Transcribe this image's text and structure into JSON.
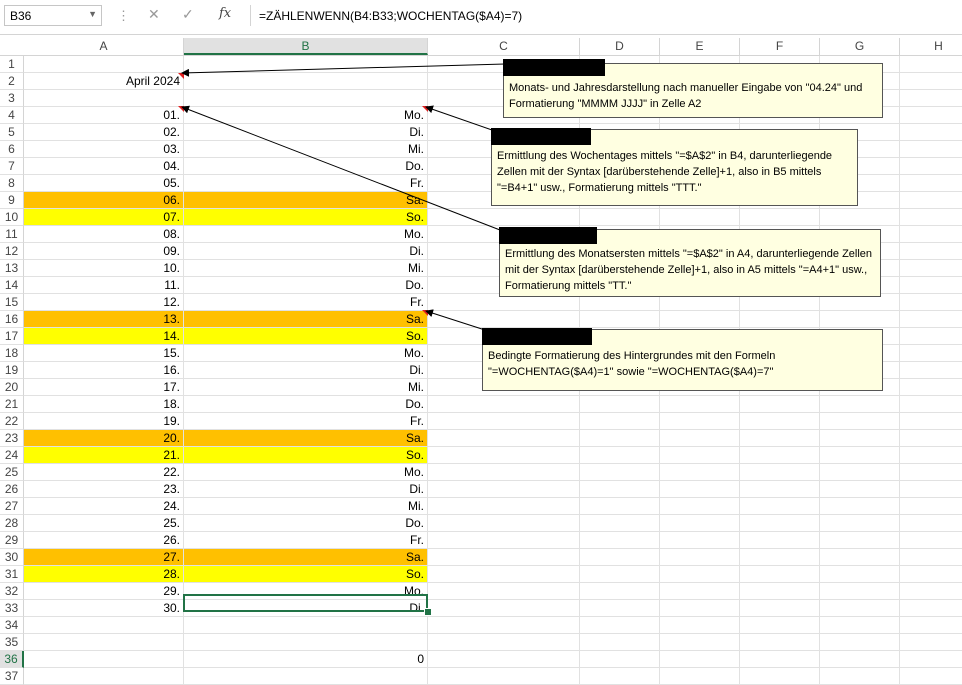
{
  "formula_bar": {
    "name_box": "B36",
    "fx_label": "fx",
    "formula": "=ZÄHLENWENN(B4:B33;WOCHENTAG($A4)=7)"
  },
  "columns": [
    "A",
    "B",
    "C",
    "D",
    "E",
    "F",
    "G",
    "H"
  ],
  "header_cell": "April 2024",
  "rows": [
    {
      "num": "1",
      "a": "",
      "b": "",
      "fill": ""
    },
    {
      "num": "2",
      "a": "April 2024",
      "b": "",
      "fill": ""
    },
    {
      "num": "3",
      "a": "",
      "b": "",
      "fill": ""
    },
    {
      "num": "4",
      "a": "01.",
      "b": "Mo.",
      "fill": ""
    },
    {
      "num": "5",
      "a": "02.",
      "b": "Di.",
      "fill": ""
    },
    {
      "num": "6",
      "a": "03.",
      "b": "Mi.",
      "fill": ""
    },
    {
      "num": "7",
      "a": "04.",
      "b": "Do.",
      "fill": ""
    },
    {
      "num": "8",
      "a": "05.",
      "b": "Fr.",
      "fill": ""
    },
    {
      "num": "9",
      "a": "06.",
      "b": "Sa.",
      "fill": "sat"
    },
    {
      "num": "10",
      "a": "07.",
      "b": "So.",
      "fill": "sun"
    },
    {
      "num": "11",
      "a": "08.",
      "b": "Mo.",
      "fill": ""
    },
    {
      "num": "12",
      "a": "09.",
      "b": "Di.",
      "fill": ""
    },
    {
      "num": "13",
      "a": "10.",
      "b": "Mi.",
      "fill": ""
    },
    {
      "num": "14",
      "a": "11.",
      "b": "Do.",
      "fill": ""
    },
    {
      "num": "15",
      "a": "12.",
      "b": "Fr.",
      "fill": ""
    },
    {
      "num": "16",
      "a": "13.",
      "b": "Sa.",
      "fill": "sat"
    },
    {
      "num": "17",
      "a": "14.",
      "b": "So.",
      "fill": "sun"
    },
    {
      "num": "18",
      "a": "15.",
      "b": "Mo.",
      "fill": ""
    },
    {
      "num": "19",
      "a": "16.",
      "b": "Di.",
      "fill": ""
    },
    {
      "num": "20",
      "a": "17.",
      "b": "Mi.",
      "fill": ""
    },
    {
      "num": "21",
      "a": "18.",
      "b": "Do.",
      "fill": ""
    },
    {
      "num": "22",
      "a": "19.",
      "b": "Fr.",
      "fill": ""
    },
    {
      "num": "23",
      "a": "20.",
      "b": "Sa.",
      "fill": "sat"
    },
    {
      "num": "24",
      "a": "21.",
      "b": "So.",
      "fill": "sun"
    },
    {
      "num": "25",
      "a": "22.",
      "b": "Mo.",
      "fill": ""
    },
    {
      "num": "26",
      "a": "23.",
      "b": "Di.",
      "fill": ""
    },
    {
      "num": "27",
      "a": "24.",
      "b": "Mi.",
      "fill": ""
    },
    {
      "num": "28",
      "a": "25.",
      "b": "Do.",
      "fill": ""
    },
    {
      "num": "29",
      "a": "26.",
      "b": "Fr.",
      "fill": ""
    },
    {
      "num": "30",
      "a": "27.",
      "b": "Sa.",
      "fill": "sat"
    },
    {
      "num": "31",
      "a": "28.",
      "b": "So.",
      "fill": "sun"
    },
    {
      "num": "32",
      "a": "29.",
      "b": "Mo.",
      "fill": ""
    },
    {
      "num": "33",
      "a": "30.",
      "b": "Di.",
      "fill": ""
    },
    {
      "num": "34",
      "a": "",
      "b": "",
      "fill": ""
    },
    {
      "num": "35",
      "a": "",
      "b": "",
      "fill": ""
    },
    {
      "num": "36",
      "a": "",
      "b": "0",
      "fill": ""
    },
    {
      "num": "37",
      "a": "",
      "b": "",
      "fill": ""
    }
  ],
  "comments": {
    "c1": "Monats- und Jahresdarstellung nach manueller Eingabe von \"04.24\" und Formatierung \"MMMM JJJJ\" in Zelle A2",
    "c2": "Ermittlung des Wochentages mittels \"=$A$2\" in B4, darunterliegende Zellen mit der Syntax [darüberstehende Zelle]+1, also in B5 mittels \"=B4+1\" usw., Formatierung mittels \"TTT.\"",
    "c3": "Ermittlung des Monatsersten mittels \"=$A$2\" in A4, darunterliegende Zellen mit der Syntax [darüberstehende Zelle]+1, also in A5 mittels \"=A4+1\" usw., Formatierung mittels \"TT.\"",
    "c4": "Bedingte Formatierung des Hintergrundes mit den Formeln \"=WOCHENTAG($A4)=1\" sowie \"=WOCHENTAG($A4)=7\""
  },
  "colors": {
    "saturday": "#ffc000",
    "sunday": "#ffff00",
    "accent": "#217346",
    "comment_bg": "#ffffe1"
  }
}
